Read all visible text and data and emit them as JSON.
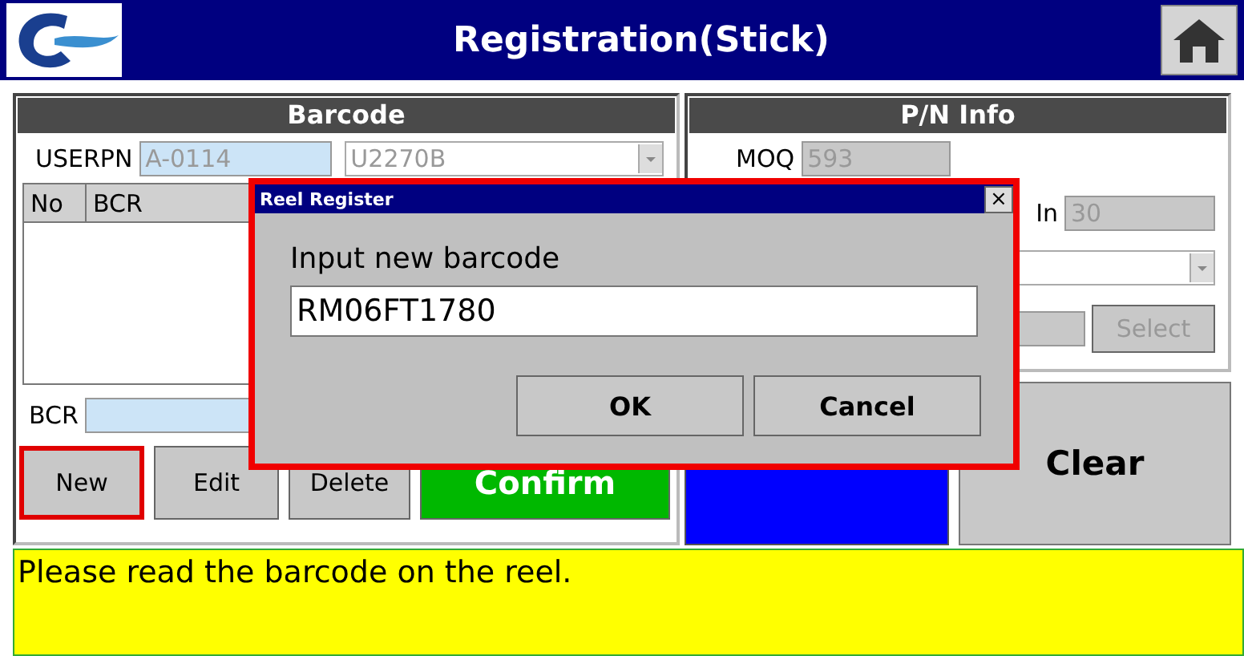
{
  "window": {
    "title": "Registration(Stick)"
  },
  "barcode_panel": {
    "title": "Barcode",
    "userpn_label": "USERPN",
    "userpn_value": "A-0114",
    "part_value": "U2270B",
    "table_columns": [
      "No",
      "BCR"
    ],
    "bcr_label": "BCR",
    "buttons": [
      {
        "label": "New",
        "kind": "plain",
        "highlighted": true
      },
      {
        "label": "Edit",
        "kind": "plain",
        "highlighted": false
      },
      {
        "label": "Delete",
        "kind": "plain",
        "highlighted": false
      },
      {
        "label": "Confirm",
        "kind": "confirm",
        "highlighted": false
      }
    ]
  },
  "pn_info_panel": {
    "title": "P/N Info",
    "moq_label": "MOQ",
    "moq_value": "593",
    "in_label": "In",
    "in_value": "30",
    "select_button": {
      "label": "Select",
      "disabled": true
    }
  },
  "clear_button": {
    "label": "Clear"
  },
  "message": "Please read the barcode on the reel.",
  "dialog": {
    "title": "Reel Register",
    "close": "×",
    "prompt": "Input new barcode",
    "value": "RM06FT1780",
    "highlighted": true,
    "buttons": [
      "OK",
      "Cancel"
    ]
  }
}
